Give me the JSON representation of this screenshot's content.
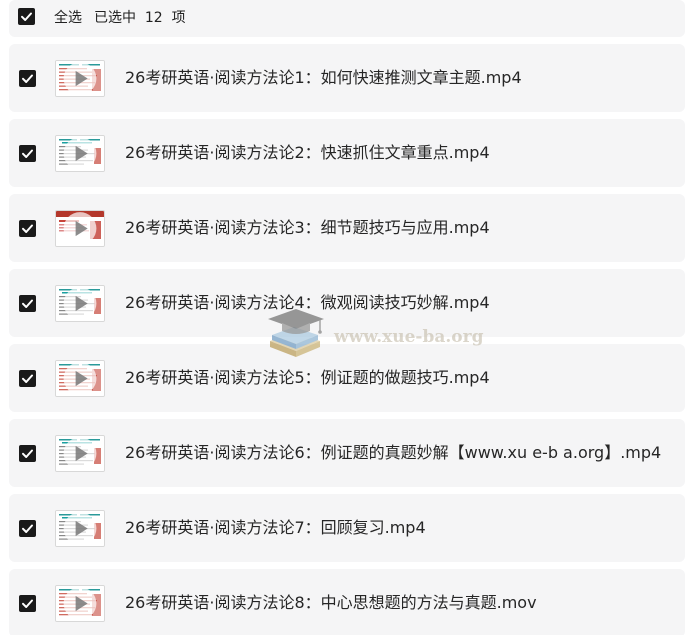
{
  "header": {
    "select_all_label": "全选",
    "selected_text": "已选中  12  项",
    "all_checked": true
  },
  "files": [
    {
      "name": "26考研英语·阅读方法论1：如何快速推测文章主题.mp4",
      "checked": true,
      "thumb_style": "red-text"
    },
    {
      "name": "26考研英语·阅读方法论2：快速抓住文章重点.mp4",
      "checked": true,
      "thumb_style": "teal-text"
    },
    {
      "name": "26考研英语·阅读方法论3：细节题技巧与应用.mp4",
      "checked": true,
      "thumb_style": "red-slide"
    },
    {
      "name": "26考研英语·阅读方法论4：微观阅读技巧妙解.mp4",
      "checked": true,
      "thumb_style": "teal-text"
    },
    {
      "name": "26考研英语·阅读方法论5：例证题的做题技巧.mp4",
      "checked": true,
      "thumb_style": "red-text"
    },
    {
      "name": "26考研英语·阅读方法论6：例证题的真题妙解【www.xu e-b a.org】.mp4",
      "checked": true,
      "thumb_style": "teal-text"
    },
    {
      "name": "26考研英语·阅读方法论7：回顾复习.mp4",
      "checked": true,
      "thumb_style": "teal-text"
    },
    {
      "name": "26考研英语·阅读方法论8：中心思想题的方法与真题.mov",
      "checked": true,
      "thumb_style": "red-text"
    }
  ],
  "watermark": {
    "text": "www.xue-ba.org",
    "icon": "graduation-cap-books-logo"
  },
  "colors": {
    "row_background": "#f5f5f6",
    "checkbox": "#1a1a1a",
    "text": "#262626"
  }
}
